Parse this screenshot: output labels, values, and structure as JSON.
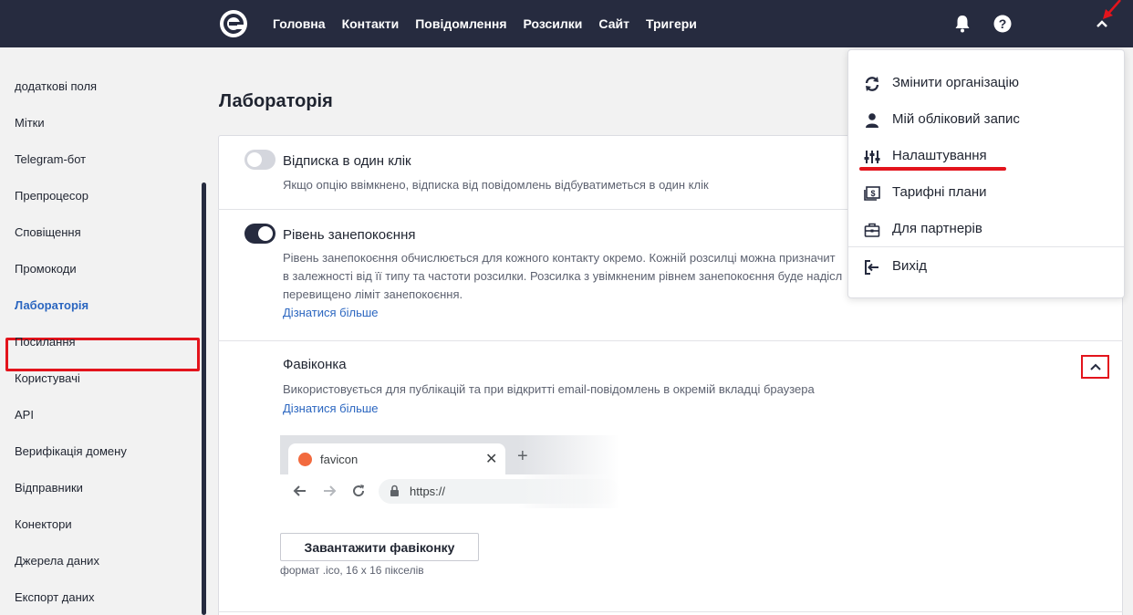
{
  "topbar": {
    "nav": [
      "Головна",
      "Контакти",
      "Повідомлення",
      "Розсилки",
      "Сайт",
      "Тригери"
    ],
    "icons": [
      "logo-icon",
      "bell-icon",
      "help-icon",
      "chevron-up-icon"
    ]
  },
  "sidebar": {
    "items": [
      "додаткові поля",
      "Мітки",
      "Telegram-бот",
      "Препроцесор",
      "Сповіщення",
      "Промокоди",
      "Лабораторія",
      "Посилання",
      "Користувачі",
      "API",
      "Верифікація домену",
      "Відправники",
      "Конектори",
      "Джерела даних",
      "Експорт даних"
    ],
    "active": "Лабораторія"
  },
  "main": {
    "title": "Лабораторія",
    "options": [
      {
        "title": "Відписка в один клік",
        "desc": "Якщо опцію ввімкнено, відписка від повідомлень відбуватиметься в один клік",
        "enabled": false
      },
      {
        "title": "Рівень занепокоєння",
        "desc_lines": [
          "Рівень занепокоєння обчислюється для кожного контакту окремо. Кожній розсилці можна призначит",
          "в залежності від її типу та частоти розсилки. Розсилка з увімкненим рівнем занепокоєння буде надісл",
          "перевищено ліміт занепокоєння."
        ],
        "link": "Дізнатися більше",
        "enabled": true
      }
    ],
    "favicon": {
      "title": "Фавіконка",
      "desc": "Використовується для публікацій та при відкритті email-повідомлень в окремій вкладці браузера",
      "link": "Дізнатися більше",
      "preview_tab": "favicon",
      "preview_url": "https://",
      "upload_label": "Завантажити фавіконку",
      "hint": "формат .ico, 16 x 16 пікселів"
    }
  },
  "dropdown": {
    "items": [
      {
        "label": "Змінити організацію",
        "icon": "refresh-icon"
      },
      {
        "label": "Мій обліковий запис",
        "icon": "user-icon"
      },
      {
        "label": "Налаштування",
        "icon": "sliders-icon"
      },
      {
        "label": "Тарифні плани",
        "icon": "money-icon"
      },
      {
        "label": "Для партнерів",
        "icon": "briefcase-icon"
      },
      {
        "label": "Вихід",
        "icon": "logout-icon"
      }
    ]
  },
  "colors": {
    "topbar": "#262b3f",
    "accent_link": "#2b66c0",
    "highlight": "#e3141c"
  }
}
